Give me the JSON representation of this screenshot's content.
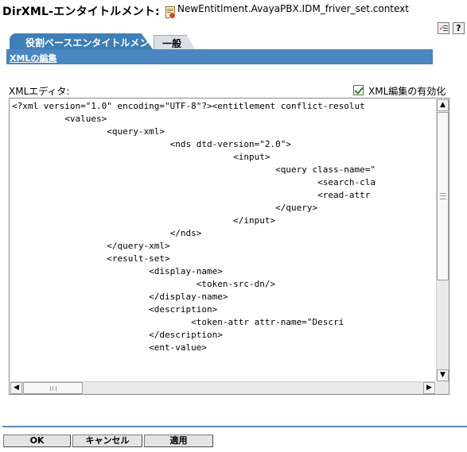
{
  "header": {
    "title": "DirXML-エンタイトルメント:",
    "object_name": "NewEntitlment.AvayaPBX.IDM_friver_set.context",
    "object_icon": "entitlement-object-icon"
  },
  "toolbar": {
    "help_label": "?",
    "icons": [
      "checklist-icon",
      "help-icon"
    ]
  },
  "tabs": [
    {
      "label": "役割ベースエンタイトルメント",
      "active": true
    },
    {
      "label": "一般",
      "active": false
    }
  ],
  "subtab": {
    "label": "XMLの編集"
  },
  "editor": {
    "label": "XMLエディタ:",
    "enable_label": "XML編集の有効化",
    "enable_checked": true,
    "lines": [
      "<?xml version=\"1.0\" encoding=\"UTF-8\"?><entitlement conflict-resolut",
      "          <values>",
      "                  <query-xml>",
      "                              <nds dtd-version=\"2.0\">",
      "                                          <input>",
      "                                                  <query class-name=\"",
      "                                                          <search-cla",
      "                                                          <read-attr",
      "                                                  </query>",
      "                                          </input>",
      "                              </nds>",
      "                  </query-xml>",
      "                  <result-set>",
      "                          <display-name>",
      "                                   <token-src-dn/>",
      "                          </display-name>",
      "                          <description>",
      "                                  <token-attr attr-name=\"Descri",
      "                          </description>",
      "                          <ent-value>"
    ]
  },
  "buttons": {
    "ok": "OK",
    "cancel": "キャンセル",
    "apply": "適用"
  },
  "colors": {
    "tab_active": "#3f7fb7",
    "subbar": "#4a86c0",
    "separator": "#5d8ab8",
    "checkbox_check": "#1e8a1e"
  }
}
